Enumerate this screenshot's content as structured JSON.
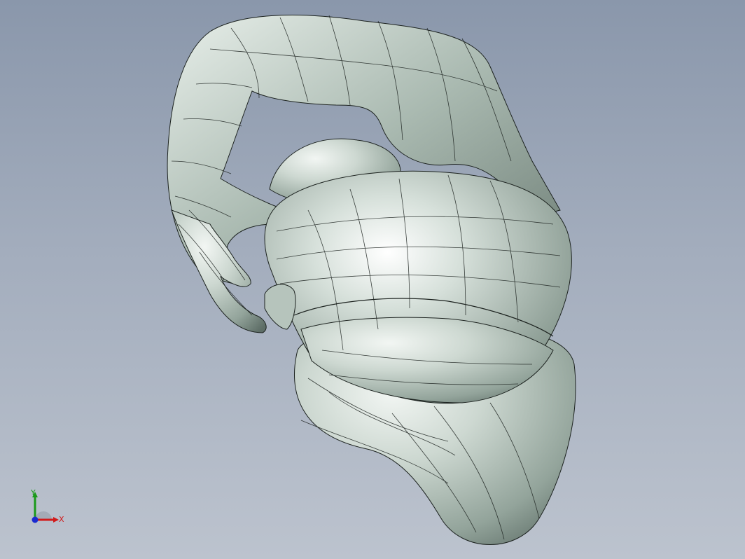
{
  "viewport": {
    "background_top": "#8a97ab",
    "background_bottom": "#bcc3ce"
  },
  "model": {
    "description_icon": "3d-mesh-model",
    "surface_color": "#bfcdc4",
    "wire_color": "#1c221f"
  },
  "triad": {
    "x_label": "X",
    "y_label": "Y",
    "x_color": "#d11a1a",
    "y_color": "#1a9a1a",
    "z_color": "#1a2ad0"
  }
}
